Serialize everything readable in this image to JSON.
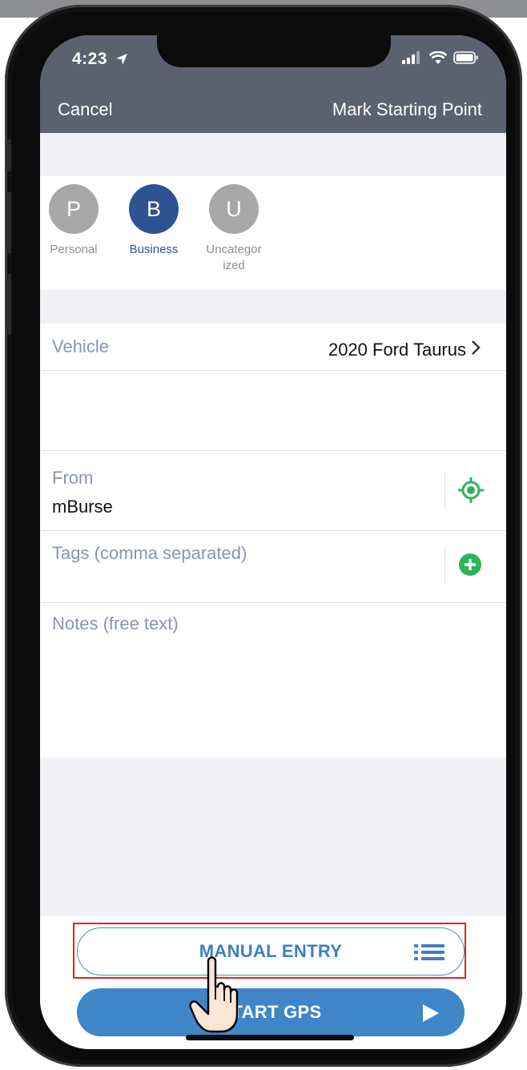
{
  "status_bar": {
    "time": "4:23"
  },
  "nav": {
    "cancel": "Cancel",
    "title": "Mark Starting Point"
  },
  "categories": [
    {
      "letter": "P",
      "label": "Personal",
      "color": "#a7a7a9",
      "selected": false
    },
    {
      "letter": "B",
      "label": "Business",
      "color": "#2e5393",
      "selected": true
    },
    {
      "letter": "U",
      "label": "Uncategor\nized",
      "color": "#a7a7a9",
      "selected": false
    }
  ],
  "vehicle": {
    "label": "Vehicle",
    "value": "2020 Ford Taurus"
  },
  "from": {
    "label": "From",
    "value": "mBurse"
  },
  "tags": {
    "placeholder": "Tags (comma separated)"
  },
  "notes": {
    "placeholder": "Notes (free text)"
  },
  "buttons": {
    "manual_entry": "MANUAL ENTRY",
    "start_gps": "START GPS"
  },
  "colors": {
    "nav_bg": "#5a6270",
    "accent_blue": "#3f86c9",
    "green_icon": "#2fb35a",
    "highlight_red": "#d9261c"
  },
  "icons": [
    "location-arrow-icon",
    "signal-icon",
    "wifi-icon",
    "battery-icon",
    "chevron-right-icon",
    "crosshair-location-icon",
    "add-circle-icon",
    "list-icon",
    "play-icon",
    "pointing-hand-icon"
  ]
}
